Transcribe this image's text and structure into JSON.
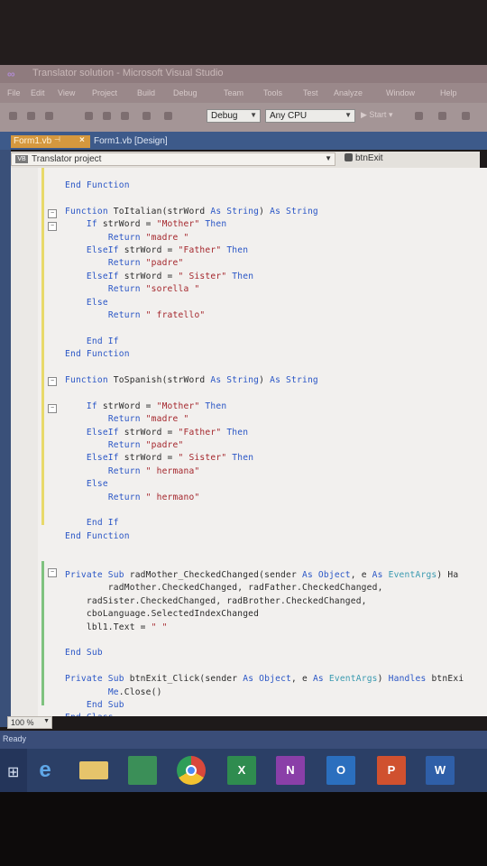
{
  "window": {
    "title": "Translator solution - Microsoft Visual Studio"
  },
  "menu": [
    "File",
    "Edit",
    "View",
    "Project",
    "Build",
    "Debug",
    "Team",
    "Tools",
    "Test",
    "Analyze",
    "Window",
    "Help"
  ],
  "toolbar": {
    "config": "Debug",
    "platform": "Any CPU",
    "start_label": "Start"
  },
  "tabs": [
    {
      "label": "Form1.vb",
      "active": true
    },
    {
      "label": "Form1.vb [Design]",
      "active": false
    }
  ],
  "navbar": {
    "project": "Translator project",
    "member": "btnExit"
  },
  "code_lines": [
    "End Function",
    "",
    "Function ToItalian(strWord As String) As String",
    "    If strWord = \"Mother\" Then",
    "        Return \"madre \"",
    "    ElseIf strWord = \"Father\" Then",
    "        Return \"padre\"",
    "    ElseIf strWord = \" Sister\" Then",
    "        Return \"sorella \"",
    "    Else",
    "        Return \" fratello\"",
    "",
    "    End If",
    "End Function",
    "",
    "Function ToSpanish(strWord As String) As String",
    "",
    "    If strWord = \"Mother\" Then",
    "        Return \"madre \"",
    "    ElseIf strWord = \"Father\" Then",
    "        Return \"padre\"",
    "    ElseIf strWord = \" Sister\" Then",
    "        Return \" hermana\"",
    "    Else",
    "        Return \" hermano\"",
    "",
    "    End If",
    "End Function",
    "",
    "",
    "Private Sub radMother_CheckedChanged(sender As Object, e As EventArgs) Ha",
    "        radMother.CheckedChanged, radFather.CheckedChanged,",
    "    radSister.CheckedChanged, radBrother.CheckedChanged,",
    "    cboLanguage.SelectedIndexChanged",
    "    lbl1.Text = \" \"",
    "",
    "End Sub",
    "",
    "Private Sub btnExit_Click(sender As Object, e As EventArgs) Handles btnExi",
    "        Me.Close()",
    "    End Sub",
    "End Class"
  ],
  "status": {
    "zoom": "100 %",
    "ready": "Ready"
  },
  "taskbar": {
    "apps": [
      "internet-explorer",
      "file-explorer",
      "store",
      "chrome",
      "excel",
      "onenote",
      "outlook",
      "powerpoint",
      "word"
    ],
    "labels": {
      "excel": "X",
      "onenote": "N",
      "outlook": "O",
      "powerpoint": "P",
      "word": "W"
    }
  },
  "colors": {
    "keyword": "#2a56c6",
    "string": "#a4262c",
    "type": "#3a9ab0",
    "tab_active": "#d5983e"
  }
}
